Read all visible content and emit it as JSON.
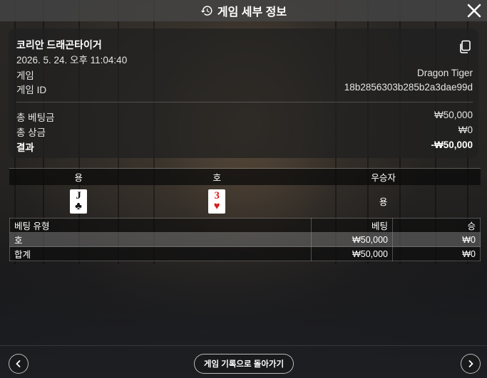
{
  "header": {
    "title": "게임 세부 정보",
    "history_icon": "history-clock-icon",
    "close_icon": "close-icon"
  },
  "summary": {
    "game_name": "코리안 드래곤타이거",
    "datetime": "2026. 5. 24. 오후 11:04:40",
    "copy_icon": "copy-icon",
    "rows": [
      {
        "label": "게임",
        "value": "Dragon Tiger"
      },
      {
        "label": "게임 ID",
        "value": "18b2856303b285b2a3dae99d"
      }
    ],
    "totals": [
      {
        "label": "총 베팅금",
        "value": "₩50,000"
      },
      {
        "label": "총 상금",
        "value": "₩0"
      },
      {
        "label": "결과",
        "value": "-₩50,000"
      }
    ]
  },
  "result": {
    "headers": [
      "용",
      "호",
      "우승자"
    ],
    "dragon_card": {
      "rank": "J",
      "suit": "♣",
      "color": "#111111"
    },
    "tiger_card": {
      "rank": "3",
      "suit": "♥",
      "color": "#d71e1e"
    },
    "winner": "용"
  },
  "bets": {
    "headers": [
      "베팅 유형",
      "베팅",
      "승"
    ],
    "rows": [
      {
        "type": "호",
        "bet": "₩50,000",
        "win": "₩0"
      },
      {
        "type": "합계",
        "bet": "₩50,000",
        "win": "₩0"
      }
    ]
  },
  "footer": {
    "back_label": "게임 기록으로 돌아가기",
    "prev_icon": "chevron-left-icon",
    "next_icon": "chevron-right-icon"
  }
}
